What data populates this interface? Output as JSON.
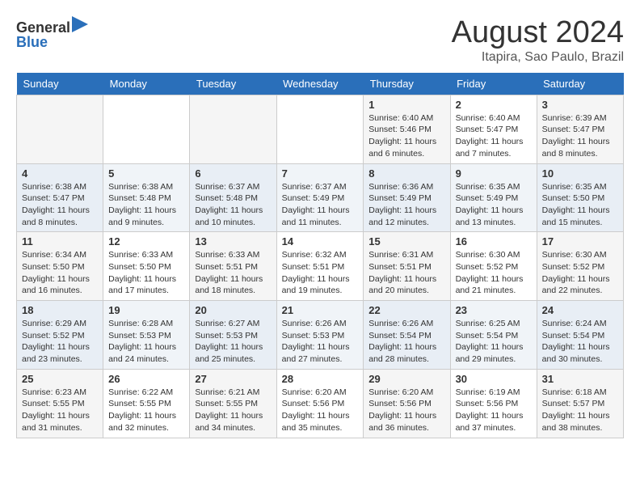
{
  "header": {
    "logo_line1": "General",
    "logo_line2": "Blue",
    "month": "August 2024",
    "location": "Itapira, Sao Paulo, Brazil"
  },
  "columns": [
    "Sunday",
    "Monday",
    "Tuesday",
    "Wednesday",
    "Thursday",
    "Friday",
    "Saturday"
  ],
  "weeks": [
    [
      {
        "day": "",
        "info": ""
      },
      {
        "day": "",
        "info": ""
      },
      {
        "day": "",
        "info": ""
      },
      {
        "day": "",
        "info": ""
      },
      {
        "day": "1",
        "info": "Sunrise: 6:40 AM\nSunset: 5:46 PM\nDaylight: 11 hours and 6 minutes."
      },
      {
        "day": "2",
        "info": "Sunrise: 6:40 AM\nSunset: 5:47 PM\nDaylight: 11 hours and 7 minutes."
      },
      {
        "day": "3",
        "info": "Sunrise: 6:39 AM\nSunset: 5:47 PM\nDaylight: 11 hours and 8 minutes."
      }
    ],
    [
      {
        "day": "4",
        "info": "Sunrise: 6:38 AM\nSunset: 5:47 PM\nDaylight: 11 hours and 8 minutes."
      },
      {
        "day": "5",
        "info": "Sunrise: 6:38 AM\nSunset: 5:48 PM\nDaylight: 11 hours and 9 minutes."
      },
      {
        "day": "6",
        "info": "Sunrise: 6:37 AM\nSunset: 5:48 PM\nDaylight: 11 hours and 10 minutes."
      },
      {
        "day": "7",
        "info": "Sunrise: 6:37 AM\nSunset: 5:49 PM\nDaylight: 11 hours and 11 minutes."
      },
      {
        "day": "8",
        "info": "Sunrise: 6:36 AM\nSunset: 5:49 PM\nDaylight: 11 hours and 12 minutes."
      },
      {
        "day": "9",
        "info": "Sunrise: 6:35 AM\nSunset: 5:49 PM\nDaylight: 11 hours and 13 minutes."
      },
      {
        "day": "10",
        "info": "Sunrise: 6:35 AM\nSunset: 5:50 PM\nDaylight: 11 hours and 15 minutes."
      }
    ],
    [
      {
        "day": "11",
        "info": "Sunrise: 6:34 AM\nSunset: 5:50 PM\nDaylight: 11 hours and 16 minutes."
      },
      {
        "day": "12",
        "info": "Sunrise: 6:33 AM\nSunset: 5:50 PM\nDaylight: 11 hours and 17 minutes."
      },
      {
        "day": "13",
        "info": "Sunrise: 6:33 AM\nSunset: 5:51 PM\nDaylight: 11 hours and 18 minutes."
      },
      {
        "day": "14",
        "info": "Sunrise: 6:32 AM\nSunset: 5:51 PM\nDaylight: 11 hours and 19 minutes."
      },
      {
        "day": "15",
        "info": "Sunrise: 6:31 AM\nSunset: 5:51 PM\nDaylight: 11 hours and 20 minutes."
      },
      {
        "day": "16",
        "info": "Sunrise: 6:30 AM\nSunset: 5:52 PM\nDaylight: 11 hours and 21 minutes."
      },
      {
        "day": "17",
        "info": "Sunrise: 6:30 AM\nSunset: 5:52 PM\nDaylight: 11 hours and 22 minutes."
      }
    ],
    [
      {
        "day": "18",
        "info": "Sunrise: 6:29 AM\nSunset: 5:52 PM\nDaylight: 11 hours and 23 minutes."
      },
      {
        "day": "19",
        "info": "Sunrise: 6:28 AM\nSunset: 5:53 PM\nDaylight: 11 hours and 24 minutes."
      },
      {
        "day": "20",
        "info": "Sunrise: 6:27 AM\nSunset: 5:53 PM\nDaylight: 11 hours and 25 minutes."
      },
      {
        "day": "21",
        "info": "Sunrise: 6:26 AM\nSunset: 5:53 PM\nDaylight: 11 hours and 27 minutes."
      },
      {
        "day": "22",
        "info": "Sunrise: 6:26 AM\nSunset: 5:54 PM\nDaylight: 11 hours and 28 minutes."
      },
      {
        "day": "23",
        "info": "Sunrise: 6:25 AM\nSunset: 5:54 PM\nDaylight: 11 hours and 29 minutes."
      },
      {
        "day": "24",
        "info": "Sunrise: 6:24 AM\nSunset: 5:54 PM\nDaylight: 11 hours and 30 minutes."
      }
    ],
    [
      {
        "day": "25",
        "info": "Sunrise: 6:23 AM\nSunset: 5:55 PM\nDaylight: 11 hours and 31 minutes."
      },
      {
        "day": "26",
        "info": "Sunrise: 6:22 AM\nSunset: 5:55 PM\nDaylight: 11 hours and 32 minutes."
      },
      {
        "day": "27",
        "info": "Sunrise: 6:21 AM\nSunset: 5:55 PM\nDaylight: 11 hours and 34 minutes."
      },
      {
        "day": "28",
        "info": "Sunrise: 6:20 AM\nSunset: 5:56 PM\nDaylight: 11 hours and 35 minutes."
      },
      {
        "day": "29",
        "info": "Sunrise: 6:20 AM\nSunset: 5:56 PM\nDaylight: 11 hours and 36 minutes."
      },
      {
        "day": "30",
        "info": "Sunrise: 6:19 AM\nSunset: 5:56 PM\nDaylight: 11 hours and 37 minutes."
      },
      {
        "day": "31",
        "info": "Sunrise: 6:18 AM\nSunset: 5:57 PM\nDaylight: 11 hours and 38 minutes."
      }
    ]
  ]
}
